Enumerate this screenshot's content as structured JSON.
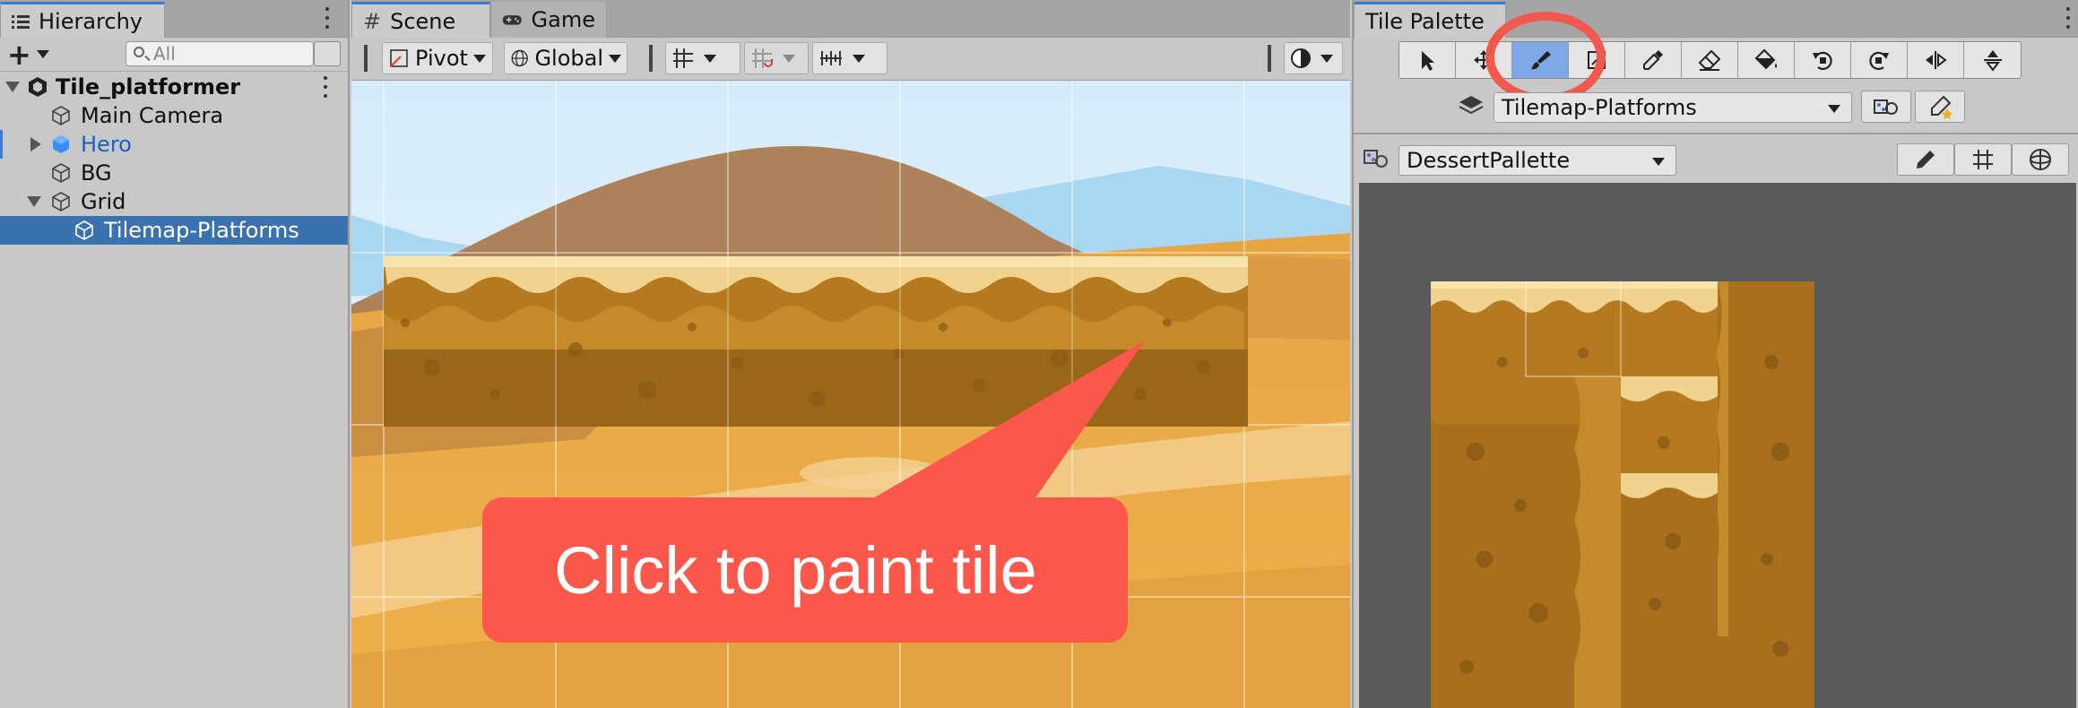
{
  "hierarchy": {
    "tab_label": "Hierarchy",
    "search_placeholder": "All",
    "items": [
      {
        "label": "Tile_platformer",
        "bold": true
      },
      {
        "label": "Main Camera"
      },
      {
        "label": "Hero"
      },
      {
        "label": "BG"
      },
      {
        "label": "Grid"
      },
      {
        "label": "Tilemap-Platforms",
        "selected": true
      }
    ]
  },
  "scene": {
    "tab_scene": "Scene",
    "tab_game": "Game",
    "pivot_label": "Pivot",
    "global_label": "Global",
    "callout_text": "Click to paint tile"
  },
  "tile_palette": {
    "tab_label": "Tile Palette",
    "active_tilemap": "Tilemap-Platforms",
    "palette_name": "DessertPallette",
    "tools": [
      "select-tool",
      "move-tool",
      "paint-brush-tool",
      "box-fill-tool",
      "picker-tool",
      "eraser-tool",
      "fill-tool",
      "rotate-ccw-tool",
      "rotate-cw-tool",
      "flip-x-tool",
      "flip-y-tool"
    ],
    "active_tool": "paint-brush-tool"
  },
  "colors": {
    "accent": "#3a79d8",
    "selection": "#3a72b0",
    "callout": "#fb584b",
    "highlight_ring": "#f2594e",
    "active_tool": "#7fa8e8"
  }
}
